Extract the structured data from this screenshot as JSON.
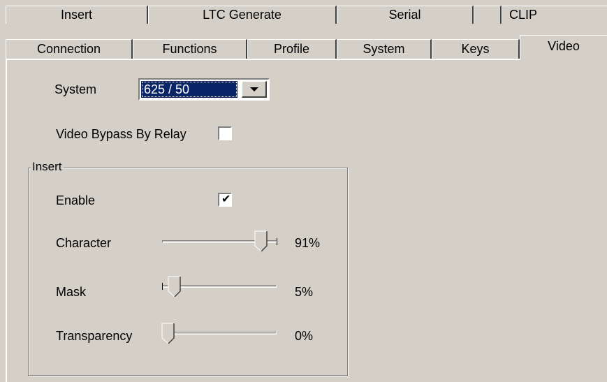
{
  "tabs_back_row": [
    {
      "label": "Insert"
    },
    {
      "label": "LTC Generate"
    },
    {
      "label": "Serial"
    },
    {
      "label": ""
    },
    {
      "label": "CLIP"
    }
  ],
  "tabs_front_row": [
    {
      "label": "Connection"
    },
    {
      "label": "Functions"
    },
    {
      "label": "Profile"
    },
    {
      "label": "System"
    },
    {
      "label": "Keys"
    },
    {
      "label": "Video"
    }
  ],
  "active_tab": "Video",
  "system": {
    "label": "System",
    "selected": "625 / 50"
  },
  "bypass": {
    "label": "Video Bypass By Relay",
    "checked": false
  },
  "insert_group": {
    "title": "Insert",
    "enable": {
      "label": "Enable",
      "checked": true
    },
    "character": {
      "label": "Character",
      "value": 91,
      "display": "91%"
    },
    "mask": {
      "label": "Mask",
      "value": 5,
      "display": "5%"
    },
    "transparency": {
      "label": "Transparency",
      "value": 0,
      "display": "0%"
    }
  },
  "colors": {
    "face": "#d4d0c8",
    "highlight": "#0a246a"
  }
}
